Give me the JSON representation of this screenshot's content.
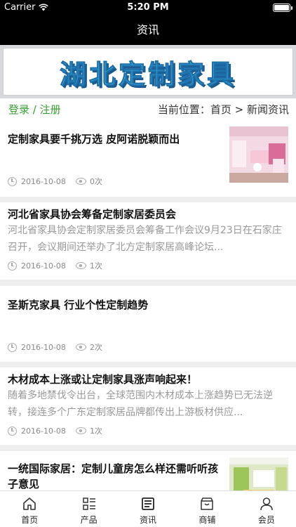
{
  "status": {
    "carrier": "Carrier",
    "time": "5:20 PM"
  },
  "nav": {
    "title": "资讯"
  },
  "banner": {
    "text": "湖北定制家具"
  },
  "info": {
    "login": "登录",
    "sep": " / ",
    "register": "注册",
    "breadcrumb": "当前位置：首页 > 新闻资讯"
  },
  "news": [
    {
      "title": "定制家具要千挑万选 皮阿诺脱颖而出",
      "desc": "",
      "date": "2016-10-08",
      "views": "0次"
    },
    {
      "title": "河北省家具协会筹备定制家居委员会",
      "desc": "河北省家具协会定制家居委员会筹备工作会议9月23日在石家庄召开，会议期间还举办了北方定制家居高峰论坛...",
      "date": "2016-10-08",
      "views": "1次"
    },
    {
      "title": "圣斯克家具 行业个性定制趋势",
      "desc": "",
      "date": "2016-10-08",
      "views": "2次"
    },
    {
      "title": "木材成本上涨或让定制家具涨声响起来！",
      "desc": "随着多地禁伐令出台，全球范围内木材成本上涨趋势已无法逆转，接连多个广东定制家居品牌都传出上游板材供应...",
      "date": "2016-10-08",
      "views": "1次"
    },
    {
      "title": "一统国际家居：定制儿童房怎么样还需听听孩子意见",
      "desc": "",
      "date": "",
      "views": ""
    }
  ],
  "tabs": [
    {
      "label": "首页",
      "icon": "home-icon"
    },
    {
      "label": "产品",
      "icon": "list-icon"
    },
    {
      "label": "资讯",
      "icon": "news-icon"
    },
    {
      "label": "商铺",
      "icon": "shop-icon"
    },
    {
      "label": "会员",
      "icon": "user-icon"
    }
  ]
}
